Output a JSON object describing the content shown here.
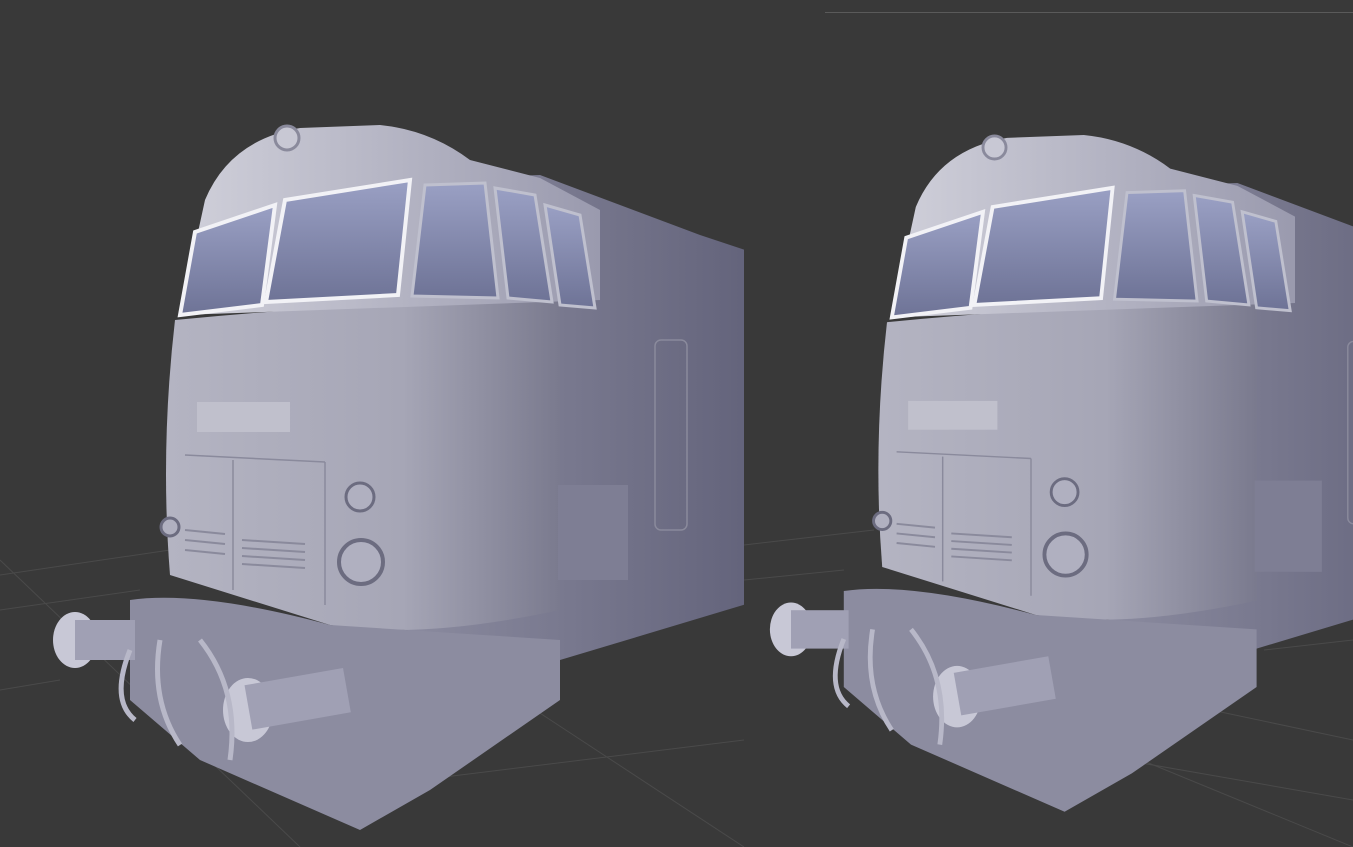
{
  "viewports": [
    {
      "name": "left",
      "view": "perspective",
      "object": "locomotive"
    },
    {
      "name": "right",
      "view": "perspective",
      "object": "locomotive"
    }
  ],
  "colors": {
    "background": "#393939",
    "grid": "#4a4a4a",
    "body": "#a8a8b8",
    "body_shadow": "#6e6e82",
    "glass": "#8c92b4",
    "window_frame": "#f2f2f6"
  }
}
